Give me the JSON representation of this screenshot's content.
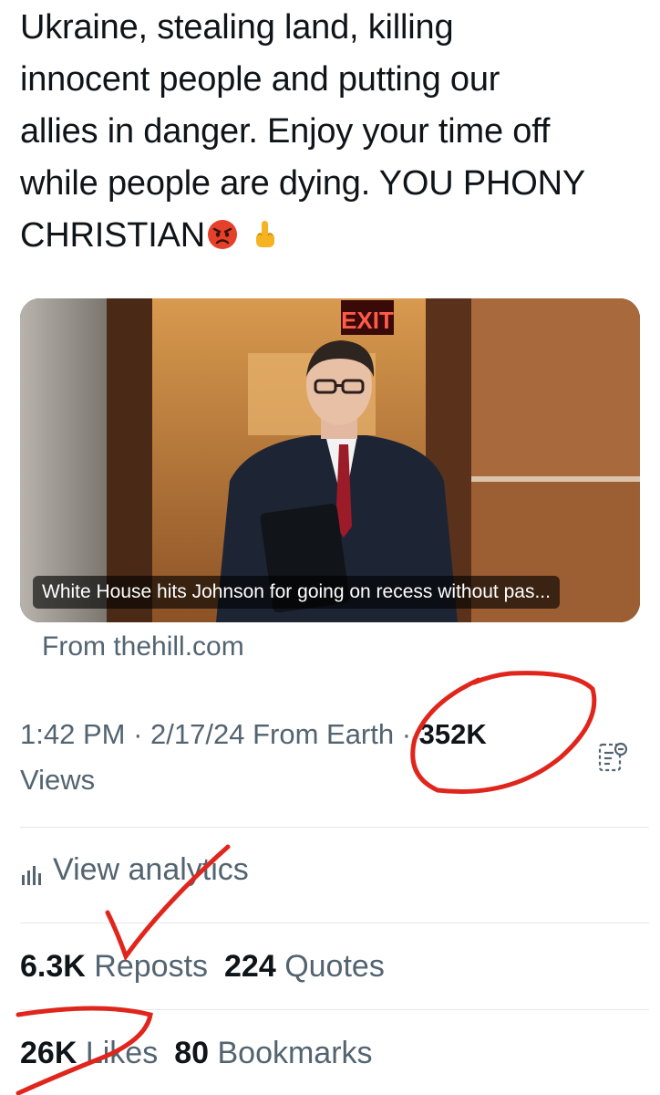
{
  "tweet": {
    "lines": [
      "Ukraine, stealing land, killing",
      "innocent people and putting our",
      "allies in danger. Enjoy your time off",
      "while people are dying. YOU PHONY",
      "CHRISTIAN"
    ],
    "emojis": [
      "angry-face",
      "middle-finger"
    ]
  },
  "card": {
    "caption": "White House hits Johnson for going on recess without pas...",
    "exit_sign": "EXIT",
    "source": "From thehill.com"
  },
  "meta": {
    "time": "1:42 PM",
    "date": "2/17/24",
    "client": "From Earth",
    "views_count": "352K",
    "views_label": "Views",
    "separator": " · "
  },
  "analytics": {
    "label": "View analytics"
  },
  "engagement": {
    "reposts_count": "6.3K",
    "reposts_label": "Reposts",
    "quotes_count": "224",
    "quotes_label": "Quotes",
    "likes_count": "26K",
    "likes_label": "Likes",
    "bookmarks_count": "80",
    "bookmarks_label": "Bookmarks"
  },
  "colors": {
    "text": "#0f1419",
    "secondary": "#536471",
    "annotation": "#e0261c"
  }
}
